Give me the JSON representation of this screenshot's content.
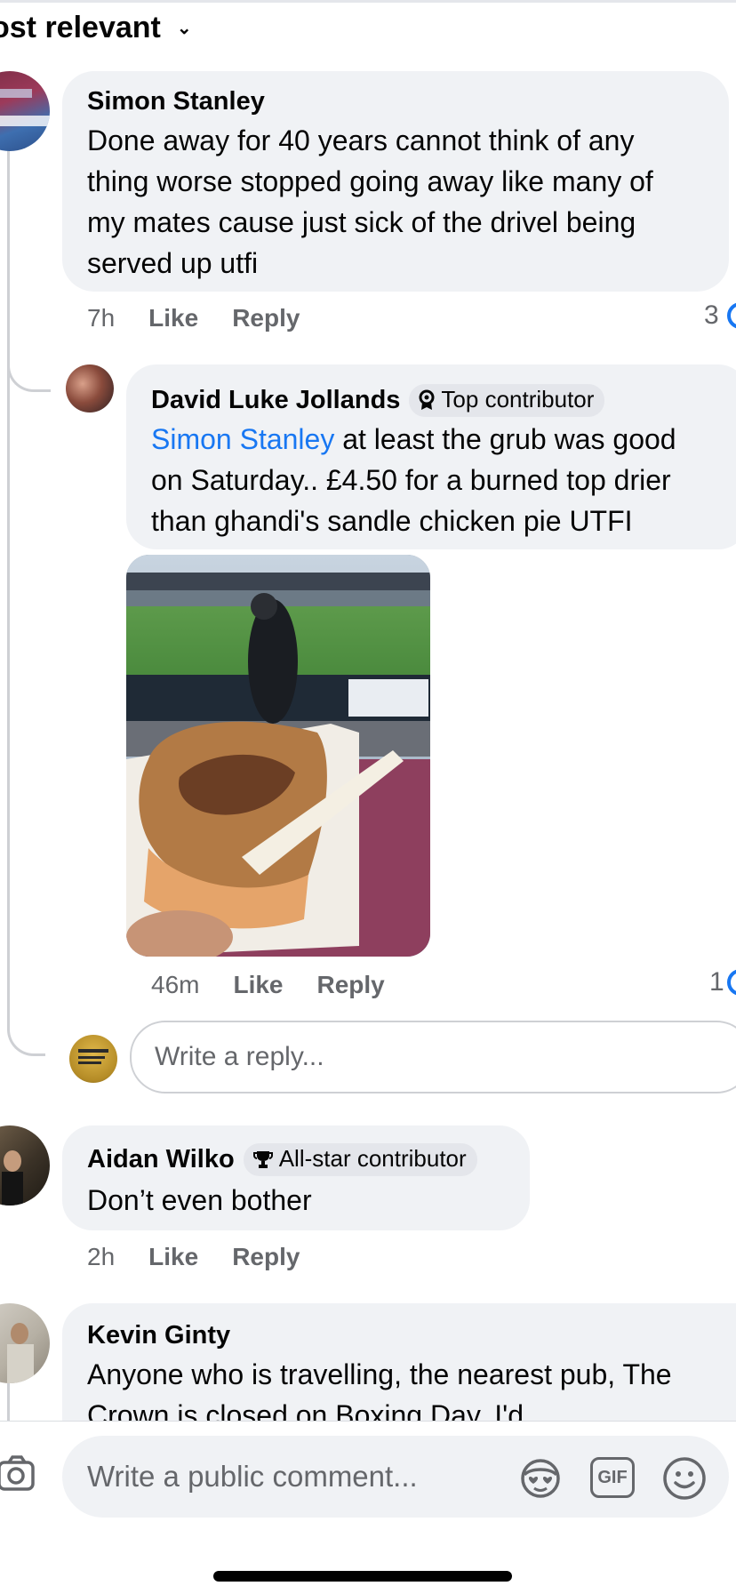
{
  "sort": {
    "label": "ost relevant",
    "chevron": "⌄"
  },
  "comments": [
    {
      "author": "Simon Stanley",
      "text_lines": [
        "Done away for 40 years cannot think of any",
        "thing worse stopped going away like many of",
        "my mates cause just sick of the drivel being",
        "served up utfi"
      ],
      "time": "7h",
      "like": "Like",
      "reply": "Reply",
      "reactions": "3"
    },
    {
      "author": "Aidan Wilko",
      "badge": "All-star contributor",
      "text": "Don’t even bother",
      "time": "2h",
      "like": "Like",
      "reply": "Reply"
    },
    {
      "author": "Kevin Ginty",
      "text_lines": [
        "Anyone who is travelling, the nearest pub, The",
        "Crown is closed on Boxing Day. I'd"
      ]
    }
  ],
  "reply": {
    "author": "David Luke Jollands",
    "badge": "Top contributor",
    "mention": "Simon Stanley",
    "text_first": " at least the grub was good",
    "text_lines": [
      "on Saturday.. £4.50 for a burned top drier",
      "than ghandi's sandle chicken pie UTFI"
    ],
    "time": "46m",
    "like": "Like",
    "reply": "Reply",
    "reactions": "1"
  },
  "reply_input": {
    "placeholder": "Write a reply..."
  },
  "composer": {
    "placeholder": "Write a public comment...",
    "gif": "GIF"
  },
  "colors": {
    "accent": "#1877f2",
    "bubble": "#f0f2f5",
    "muted": "#65676b"
  }
}
